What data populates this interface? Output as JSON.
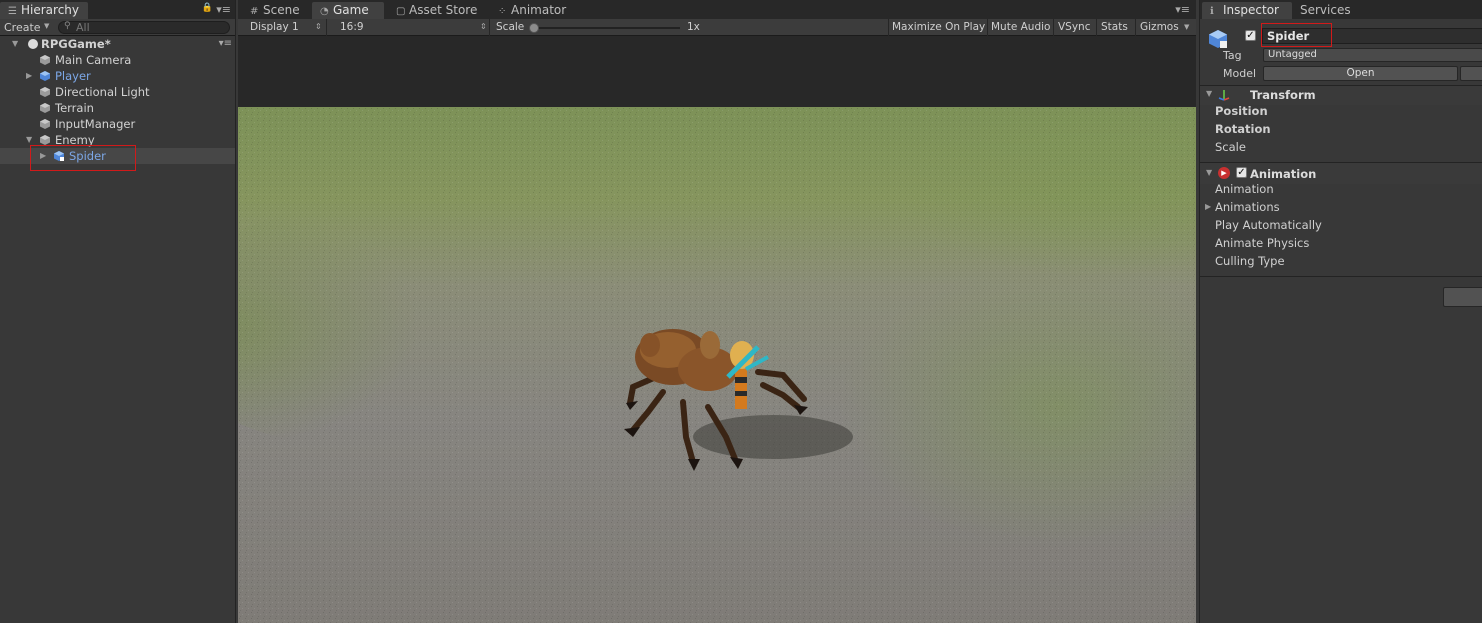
{
  "hierarchy": {
    "tab_label": "Hierarchy",
    "create_label": "Create",
    "search_placeholder": "All",
    "scene_name": "RPGGame*",
    "items": [
      {
        "label": "Main Camera"
      },
      {
        "label": "Player"
      },
      {
        "label": "Directional Light"
      },
      {
        "label": "Terrain"
      },
      {
        "label": "InputManager"
      },
      {
        "label": "Enemy"
      },
      {
        "label": "Spider"
      }
    ]
  },
  "center_tabs": [
    {
      "label": "Scene",
      "icon": "grid-icon"
    },
    {
      "label": "Game",
      "icon": "pacman-icon"
    },
    {
      "label": "Asset Store",
      "icon": "bag-icon"
    },
    {
      "label": "Animator",
      "icon": "animator-icon"
    }
  ],
  "game_toolbar": {
    "display": "Display 1",
    "aspect": "16:9",
    "scale_label": "Scale",
    "scale_value": "1x",
    "maximize": "Maximize On Play",
    "mute": "Mute Audio",
    "vsync": "VSync",
    "stats": "Stats",
    "gizmos": "Gizmos"
  },
  "inspector": {
    "tab_label": "Inspector",
    "services_tab": "Services",
    "object_name": "Spider",
    "tag_label": "Tag",
    "tag_value": "Untagged",
    "model_label": "Model",
    "open_label": "Open",
    "transform": {
      "title": "Transform",
      "position": "Position",
      "rotation": "Rotation",
      "scale": "Scale"
    },
    "animation": {
      "title": "Animation",
      "fields": [
        "Animation",
        "Animations",
        "Play Automatically",
        "Animate Physics",
        "Culling Type"
      ]
    }
  },
  "colors": {
    "selection_box": "#d11a1a",
    "prefab_blue": "#7ca7e6",
    "panel_bg": "#383838"
  }
}
